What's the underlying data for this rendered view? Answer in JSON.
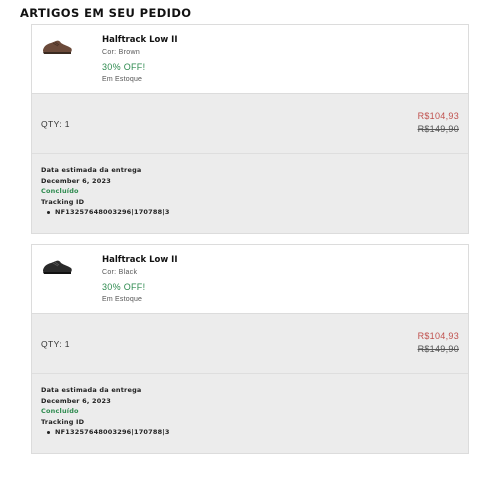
{
  "section": {
    "title": "ARTIGOS EM SEU PEDIDO"
  },
  "items": [
    {
      "name": "Halftrack Low II",
      "color_line": "Cor: Brown",
      "discount": "30% OFF!",
      "stock": "Em Estoque",
      "shoe_color": "#6b4a3a",
      "qty": "QTY: 1",
      "price_new": "R$104,93",
      "price_old": "R$149,90",
      "delivery_label": "Data estimada da entrega",
      "delivery_date": "December 6, 2023",
      "status": "Concluído",
      "tracking_label": "Tracking ID",
      "tracking_id": "NF13257648003296|170788|3"
    },
    {
      "name": "Halftrack Low II",
      "color_line": "Cor: Black",
      "discount": "30% OFF!",
      "stock": "Em Estoque",
      "shoe_color": "#2a2a2a",
      "qty": "QTY: 1",
      "price_new": "R$104,93",
      "price_old": "R$149,90",
      "delivery_label": "Data estimada da entrega",
      "delivery_date": "December 6, 2023",
      "status": "Concluído",
      "tracking_label": "Tracking ID",
      "tracking_id": "NF13257648003296|170788|3"
    }
  ]
}
